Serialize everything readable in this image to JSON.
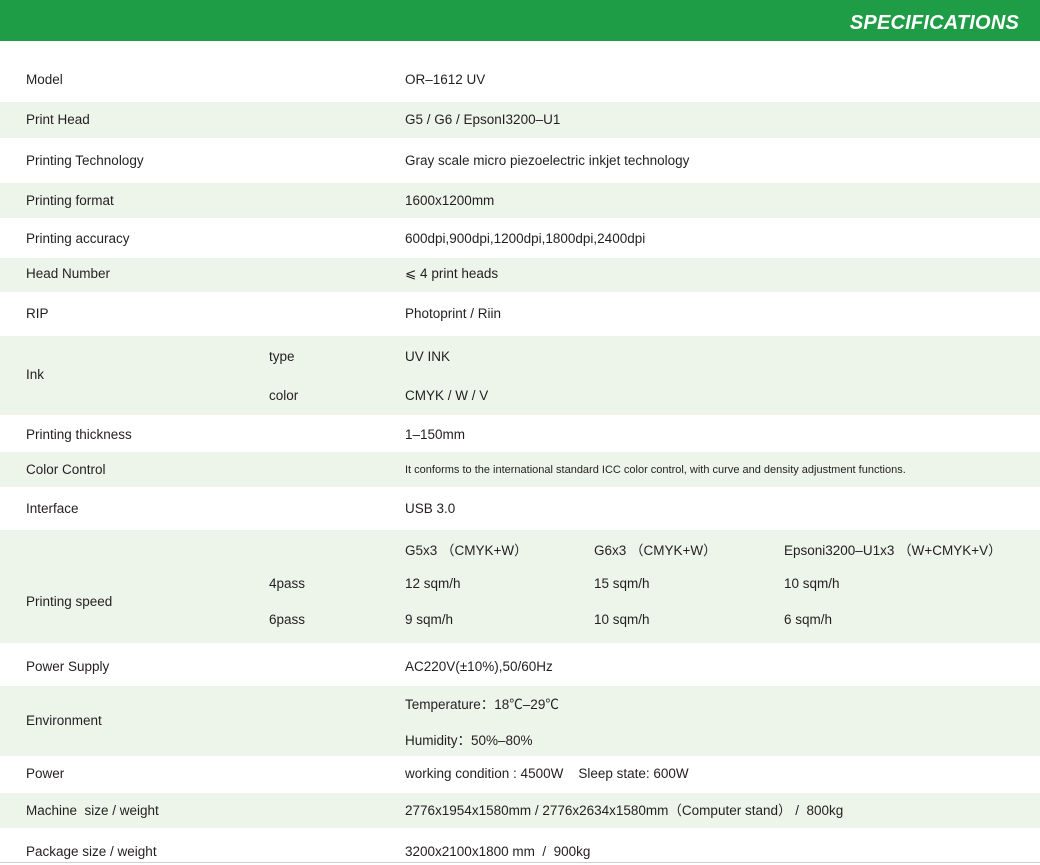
{
  "header": {
    "title": "SPECIFICATIONS",
    "color": "#1f9d46"
  },
  "rows": {
    "model": {
      "label": "Model",
      "value": "OR–1612 UV"
    },
    "print_head": {
      "label": "Print Head",
      "value": "G5 / G6 / EpsonI3200–U1"
    },
    "printing_technology": {
      "label": "Printing Technology",
      "value": "Gray scale micro piezoelectric inkjet technology"
    },
    "printing_format": {
      "label": "Printing format",
      "value": "1600x1200mm"
    },
    "printing_accuracy": {
      "label": "Printing accuracy",
      "value": "600dpi,900dpi,1200dpi,1800dpi,2400dpi"
    },
    "head_number": {
      "label": "Head Number",
      "value": "⩽ 4 print heads"
    },
    "rip": {
      "label": "RIP",
      "value": "Photoprint / Riin"
    },
    "ink": {
      "label": "Ink",
      "type_label": "type",
      "type_value": "UV INK",
      "color_label": "color",
      "color_value": "CMYK / W / V"
    },
    "printing_thickness": {
      "label": "Printing thickness",
      "value": "1–150mm"
    },
    "color_control": {
      "label": "Color Control",
      "value": "It conforms to the international standard ICC color control, with curve and density adjustment functions."
    },
    "interface": {
      "label": "Interface",
      "value": "USB 3.0"
    },
    "printing_speed": {
      "label": "Printing speed",
      "heads": [
        "G5x3 （CMYK+W）",
        "G6x3 （CMYK+W）",
        "Epsoni3200–U1x3 （W+CMYK+V）"
      ],
      "pass4_label": "4pass",
      "pass4_values": [
        "12  sqm/h",
        "15  sqm/h",
        "10  sqm/h"
      ],
      "pass6_label": "6pass",
      "pass6_values": [
        "9  sqm/h",
        "10  sqm/h",
        "6  sqm/h"
      ]
    },
    "power_supply": {
      "label": "Power Supply",
      "value": "AC220V(±10%),50/60Hz"
    },
    "environment": {
      "label": "Environment",
      "temperature": "Temperature：18℃–29℃",
      "humidity": "Humidity：50%–80%"
    },
    "power": {
      "label": "Power",
      "value": "working condition : 4500W    Sleep state: 600W"
    },
    "machine_size": {
      "label": "Machine  size / weight",
      "value": "2776x1954x1580mm / 2776x2634x1580mm（Computer stand） /  800kg"
    },
    "package_size": {
      "label": "Package size / weight",
      "value": "3200x2100x1800 mm  /  900kg"
    }
  }
}
